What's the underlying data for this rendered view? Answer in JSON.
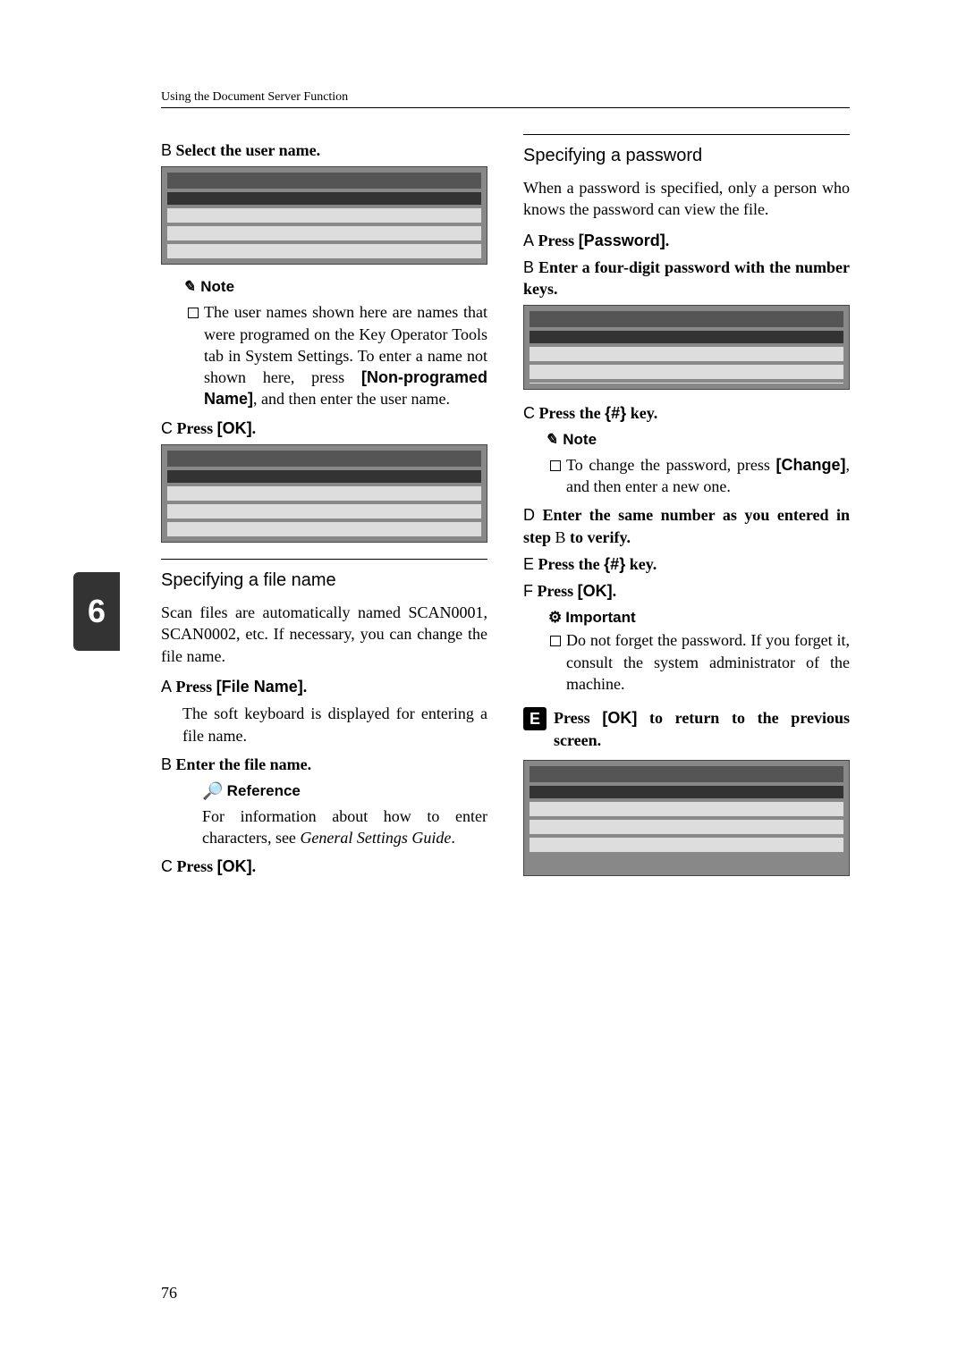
{
  "header": "Using the Document Server Function",
  "page_number": "76",
  "side_tab": "6",
  "left": {
    "stepB_label": "B",
    "stepB_text": "Select the user name.",
    "note_label": "Note",
    "note_body_1": "The user names shown here are names that were programed on the Key Operator Tools tab in System Settings. To enter a name not shown here, press ",
    "note_bold_1": "[Non-programed Name]",
    "note_body_2": ", and then enter the user name.",
    "stepC_label": "C",
    "stepC_text_pre": "Press ",
    "stepC_bold": "[OK]",
    "stepC_text_post": ".",
    "h2_filename": "Specifying a file name",
    "filename_para": "Scan files are automatically named SCAN0001, SCAN0002, etc. If necessary, you can change the file name.",
    "fA_label": "A",
    "fA_pre": "Press ",
    "fA_bold": "[File Name]",
    "fA_post": ".",
    "fA_body": "The soft keyboard is displayed for entering a file name.",
    "fB_label": "B",
    "fB_text": "Enter the file name.",
    "ref_label": "Reference",
    "ref_body_1": "For information about how to enter characters, see ",
    "ref_italic": "General Settings Guide",
    "ref_body_2": ".",
    "fC_label": "C",
    "fC_pre": "Press ",
    "fC_bold": "[OK]",
    "fC_post": "."
  },
  "right": {
    "h2_password": "Specifying a password",
    "pw_para": "When a password is specified, only a person who knows the password can view the file.",
    "pA_label": "A",
    "pA_pre": "Press ",
    "pA_bold": "[Password]",
    "pA_post": ".",
    "pB_label": "B",
    "pB_text": "Enter a four-digit password with the number keys.",
    "pC_label": "C",
    "pC_pre": "Press the ",
    "pC_hash": "{#}",
    "pC_post": " key.",
    "note_label": "Note",
    "note_body_1": "To change the password, press ",
    "note_bold_1": "[Change]",
    "note_body_2": ", and then enter a new one.",
    "pD_label": "D",
    "pD_text_pre": "Enter the same number as you entered in step ",
    "pD_ref": "B",
    "pD_text_post": " to verify.",
    "pE_label": "E",
    "pE_pre": "Press the ",
    "pE_hash": "{#}",
    "pE_post": " key.",
    "pF_label": "F",
    "pF_pre": "Press ",
    "pF_bold": "[OK]",
    "pF_post": ".",
    "imp_label": "Important",
    "imp_body": "Do not forget the password. If you forget it, consult the system administrator of the machine.",
    "big_num": "E",
    "big_pre": "Press ",
    "big_bold": "[OK]",
    "big_post": " to return to the previous screen."
  }
}
